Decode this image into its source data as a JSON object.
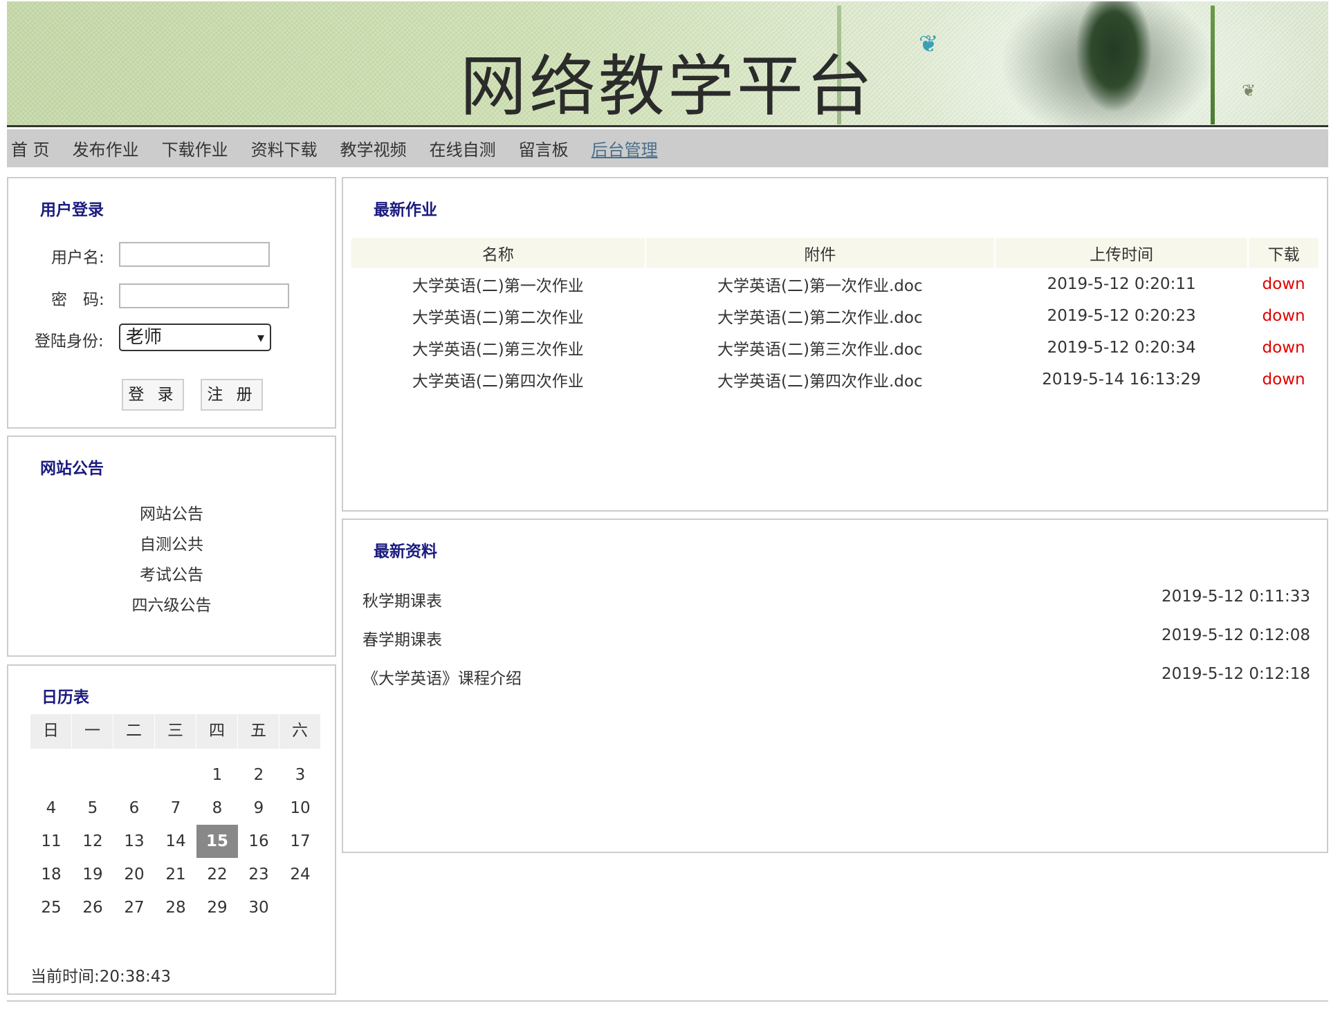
{
  "header": {
    "title": "网络教学平台"
  },
  "nav": {
    "items": [
      "首 页",
      "发布作业",
      "下载作业",
      "资料下载",
      "教学视频",
      "在线自测",
      "留言板"
    ],
    "admin": "后台管理"
  },
  "login": {
    "title": "用户登录",
    "username_label": "用户名:",
    "username_value": "",
    "password_label": "密　码:",
    "password_value": "",
    "role_label": "登陆身份:",
    "role_selected": "老师",
    "login_button": "登 录",
    "register_button": "注 册"
  },
  "notices": {
    "title": "网站公告",
    "items": [
      "网站公告",
      "自测公共",
      "考试公告",
      "四六级公告"
    ]
  },
  "calendar": {
    "title": "日历表",
    "weekdays": [
      "日",
      "一",
      "二",
      "三",
      "四",
      "五",
      "六"
    ],
    "weeks": [
      [
        "",
        "",
        "",
        "",
        "1",
        "2",
        "3"
      ],
      [
        "4",
        "5",
        "6",
        "7",
        "8",
        "9",
        "10"
      ],
      [
        "11",
        "12",
        "13",
        "14",
        "15",
        "16",
        "17"
      ],
      [
        "18",
        "19",
        "20",
        "21",
        "22",
        "23",
        "24"
      ],
      [
        "25",
        "26",
        "27",
        "28",
        "29",
        "30",
        ""
      ]
    ],
    "today": "15",
    "current_time": "当前时间:20:38:43"
  },
  "homework": {
    "title": "最新作业",
    "headers": [
      "名称",
      "附件",
      "上传时间",
      "下载"
    ],
    "rows": [
      [
        "大学英语(二)第一次作业",
        "大学英语(二)第一次作业.doc",
        "2019-5-12 0:20:11",
        "down"
      ],
      [
        "大学英语(二)第二次作业",
        "大学英语(二)第二次作业.doc",
        "2019-5-12 0:20:23",
        "down"
      ],
      [
        "大学英语(二)第三次作业",
        "大学英语(二)第三次作业.doc",
        "2019-5-12 0:20:34",
        "down"
      ],
      [
        "大学英语(二)第四次作业",
        "大学英语(二)第四次作业.doc",
        "2019-5-14 16:13:29",
        "down"
      ]
    ]
  },
  "materials": {
    "title": "最新资料",
    "items": [
      {
        "title": "秋学期课表",
        "date": "2019-5-12 0:11:33"
      },
      {
        "title": "春学期课表",
        "date": "2019-5-12 0:12:08"
      },
      {
        "title": "《大学英语》课程介绍",
        "date": "2019-5-12 0:12:18"
      }
    ]
  },
  "colors": {
    "panel_title": "#1a1a80",
    "down_link": "#e00000",
    "nav_bg": "#cccccc",
    "today_bg": "#888888",
    "admin_link": "#4a6e8a"
  }
}
